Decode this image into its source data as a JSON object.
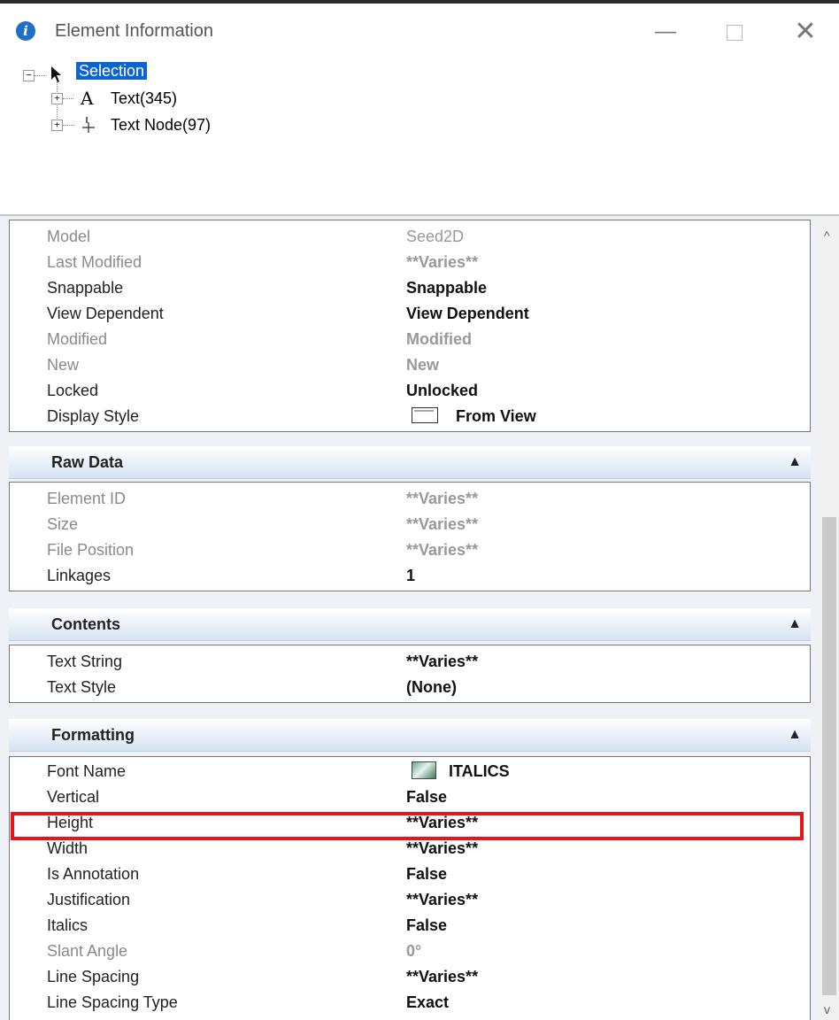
{
  "window": {
    "title": "Element Information",
    "controls": {
      "minimize": "—",
      "maximize": "□",
      "close": "✕"
    }
  },
  "tree": {
    "root": {
      "label": "Selection",
      "toggle": "−",
      "selected": true
    },
    "children": [
      {
        "label": "Text(345)",
        "toggle": "+",
        "icon": "text-a-icon"
      },
      {
        "label": "Text Node(97)",
        "toggle": "+",
        "icon": "text-node-icon"
      }
    ]
  },
  "general": {
    "rows": [
      {
        "key": "Model",
        "value": "Seed2D",
        "disabled": true
      },
      {
        "key": "Last Modified",
        "value": "**Varies**",
        "disabled": true
      },
      {
        "key": "Snappable",
        "value": "Snappable",
        "disabled": false
      },
      {
        "key": "View Dependent",
        "value": "View Dependent",
        "disabled": false
      },
      {
        "key": "Modified",
        "value": "Modified",
        "disabled": true
      },
      {
        "key": "New",
        "value": "New",
        "disabled": true
      },
      {
        "key": "Locked",
        "value": "Unlocked",
        "disabled": false
      },
      {
        "key": "Display Style",
        "value": "From View",
        "disabled": false,
        "icon": "display-style-icon"
      }
    ]
  },
  "sections": {
    "raw_data": {
      "title": "Raw Data",
      "rows": [
        {
          "key": "Element ID",
          "value": "**Varies**",
          "disabled": true
        },
        {
          "key": "Size",
          "value": "**Varies**",
          "disabled": true
        },
        {
          "key": "File Position",
          "value": "**Varies**",
          "disabled": true
        },
        {
          "key": "Linkages",
          "value": "1",
          "disabled": false
        }
      ]
    },
    "contents": {
      "title": "Contents",
      "rows": [
        {
          "key": "Text String",
          "value": "**Varies**",
          "disabled": false
        },
        {
          "key": "Text Style",
          "value": "(None)",
          "disabled": false
        }
      ]
    },
    "formatting": {
      "title": "Formatting",
      "rows": [
        {
          "key": "Font Name",
          "value": "ITALICS",
          "disabled": false,
          "icon": "font-icon"
        },
        {
          "key": "Vertical",
          "value": "False",
          "disabled": false
        },
        {
          "key": "Height",
          "value": "**Varies**",
          "disabled": false
        },
        {
          "key": "Width",
          "value": "**Varies**",
          "disabled": false
        },
        {
          "key": "Is Annotation",
          "value": "False",
          "disabled": false,
          "highlighted": true
        },
        {
          "key": "Justification",
          "value": "**Varies**",
          "disabled": false
        },
        {
          "key": "Italics",
          "value": "False",
          "disabled": false
        },
        {
          "key": "Slant Angle",
          "value": "0°",
          "disabled": true
        },
        {
          "key": "Line Spacing",
          "value": "**Varies**",
          "disabled": false
        },
        {
          "key": "Line Spacing Type",
          "value": "Exact",
          "disabled": false
        }
      ]
    }
  },
  "colors": {
    "selection_highlight": "#0a64d2",
    "section_header": "#d6e3f2",
    "annotation_highlight": "#e8141a",
    "info_icon": "#1e6fc8"
  },
  "scrollbar": {
    "up": "^",
    "down": "v"
  }
}
